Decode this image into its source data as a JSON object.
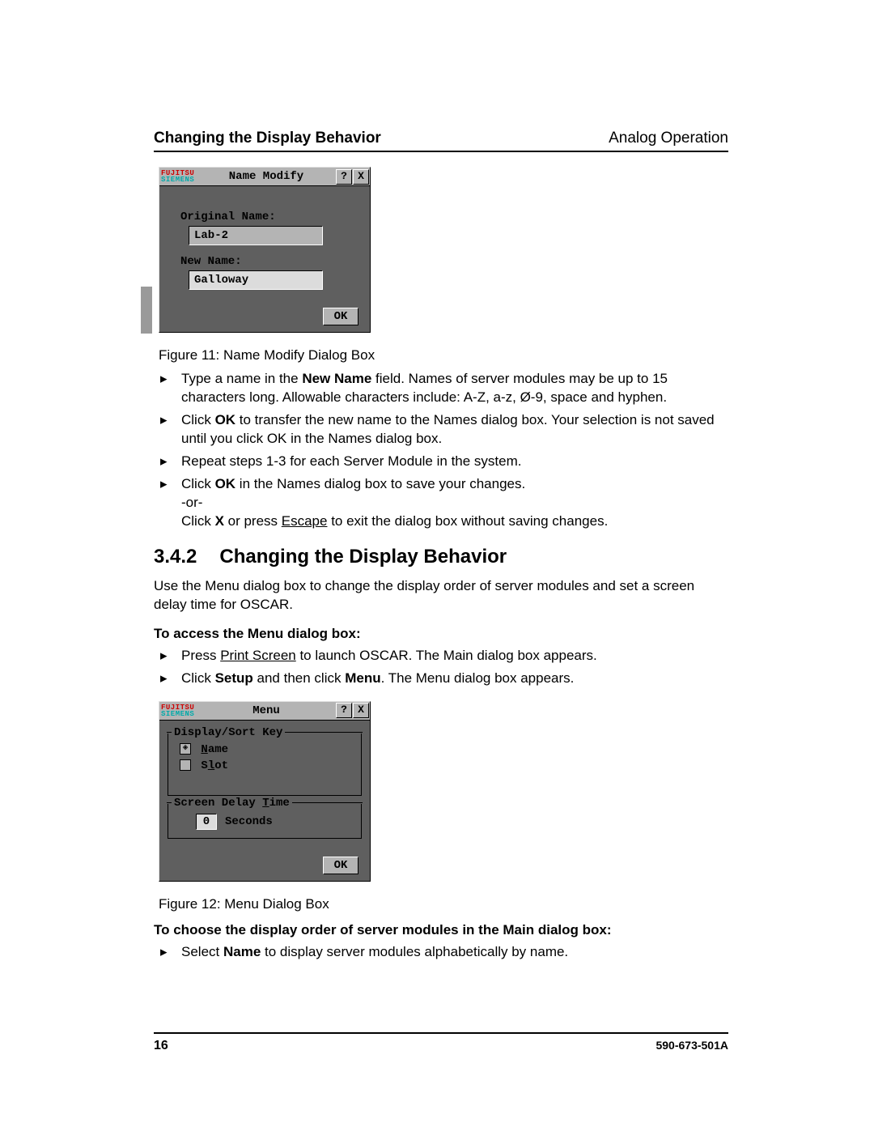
{
  "header": {
    "left": "Changing the Display Behavior",
    "right": "Analog Operation"
  },
  "dialog1": {
    "title": "Name Modify",
    "help": "?",
    "close": "X",
    "orig_label": "Original Name:",
    "orig_value": "Lab-2",
    "new_label": "New Name:",
    "new_value": "Galloway",
    "ok": "OK"
  },
  "caption1": "Figure 11: Name Modify Dialog Box",
  "bullets1": {
    "b1a": "Type a name in the ",
    "b1b": "New Name",
    "b1c": " field. Names of server modules may be up to 15 characters long. Allowable characters include: A-Z, a-z, Ø-9, space and hyphen.",
    "b2a": "Click ",
    "b2b": "OK",
    "b2c": " to transfer the new name to the Names dialog box. Your selection is not saved until you click OK in the Names dialog box.",
    "b3": "Repeat steps 1-3 for each Server Module in the system.",
    "b4a": "Click ",
    "b4b": "OK",
    "b4c": " in the Names dialog box to save your changes.",
    "b4or": "-or-",
    "b4d1": "Click ",
    "b4d2": "X",
    "b4d3": " or press ",
    "b4d4": "Escape",
    "b4d5": " to exit the dialog box without saving changes."
  },
  "section": {
    "num": "3.4.2",
    "title": "Changing the Display Behavior",
    "para": "Use the Menu dialog box to change the display order of server modules and set a screen delay time for OSCAR."
  },
  "access_heading": "To access the Menu dialog box:",
  "bullets2": {
    "b1a": "Press ",
    "b1b": "Print Screen",
    "b1c": " to launch OSCAR. The Main dialog box appears.",
    "b2a": "Click ",
    "b2b": "Setup",
    "b2c": " and then click ",
    "b2d": "Menu",
    "b2e": ". The Menu dialog box appears."
  },
  "dialog2": {
    "title": "Menu",
    "help": "?",
    "close": "X",
    "legend1": "Display/Sort Key",
    "radio_name_pre": "N",
    "radio_name_rest": "ame",
    "radio_slot_pre": "S",
    "radio_slot_mid": "l",
    "radio_slot_rest": "ot",
    "legend2_pre": "Screen Delay ",
    "legend2_u": "T",
    "legend2_rest": "ime",
    "seconds_value": "0",
    "seconds_label": "Seconds",
    "ok": "OK"
  },
  "caption2": "Figure 12: Menu Dialog Box",
  "choose_heading": "To choose the display order of server modules in the Main dialog box:",
  "bullets3": {
    "b1a": "Select ",
    "b1b": "Name",
    "b1c": " to display server modules alphabetically by name."
  },
  "footer": {
    "page": "16",
    "doc": "590-673-501A"
  }
}
